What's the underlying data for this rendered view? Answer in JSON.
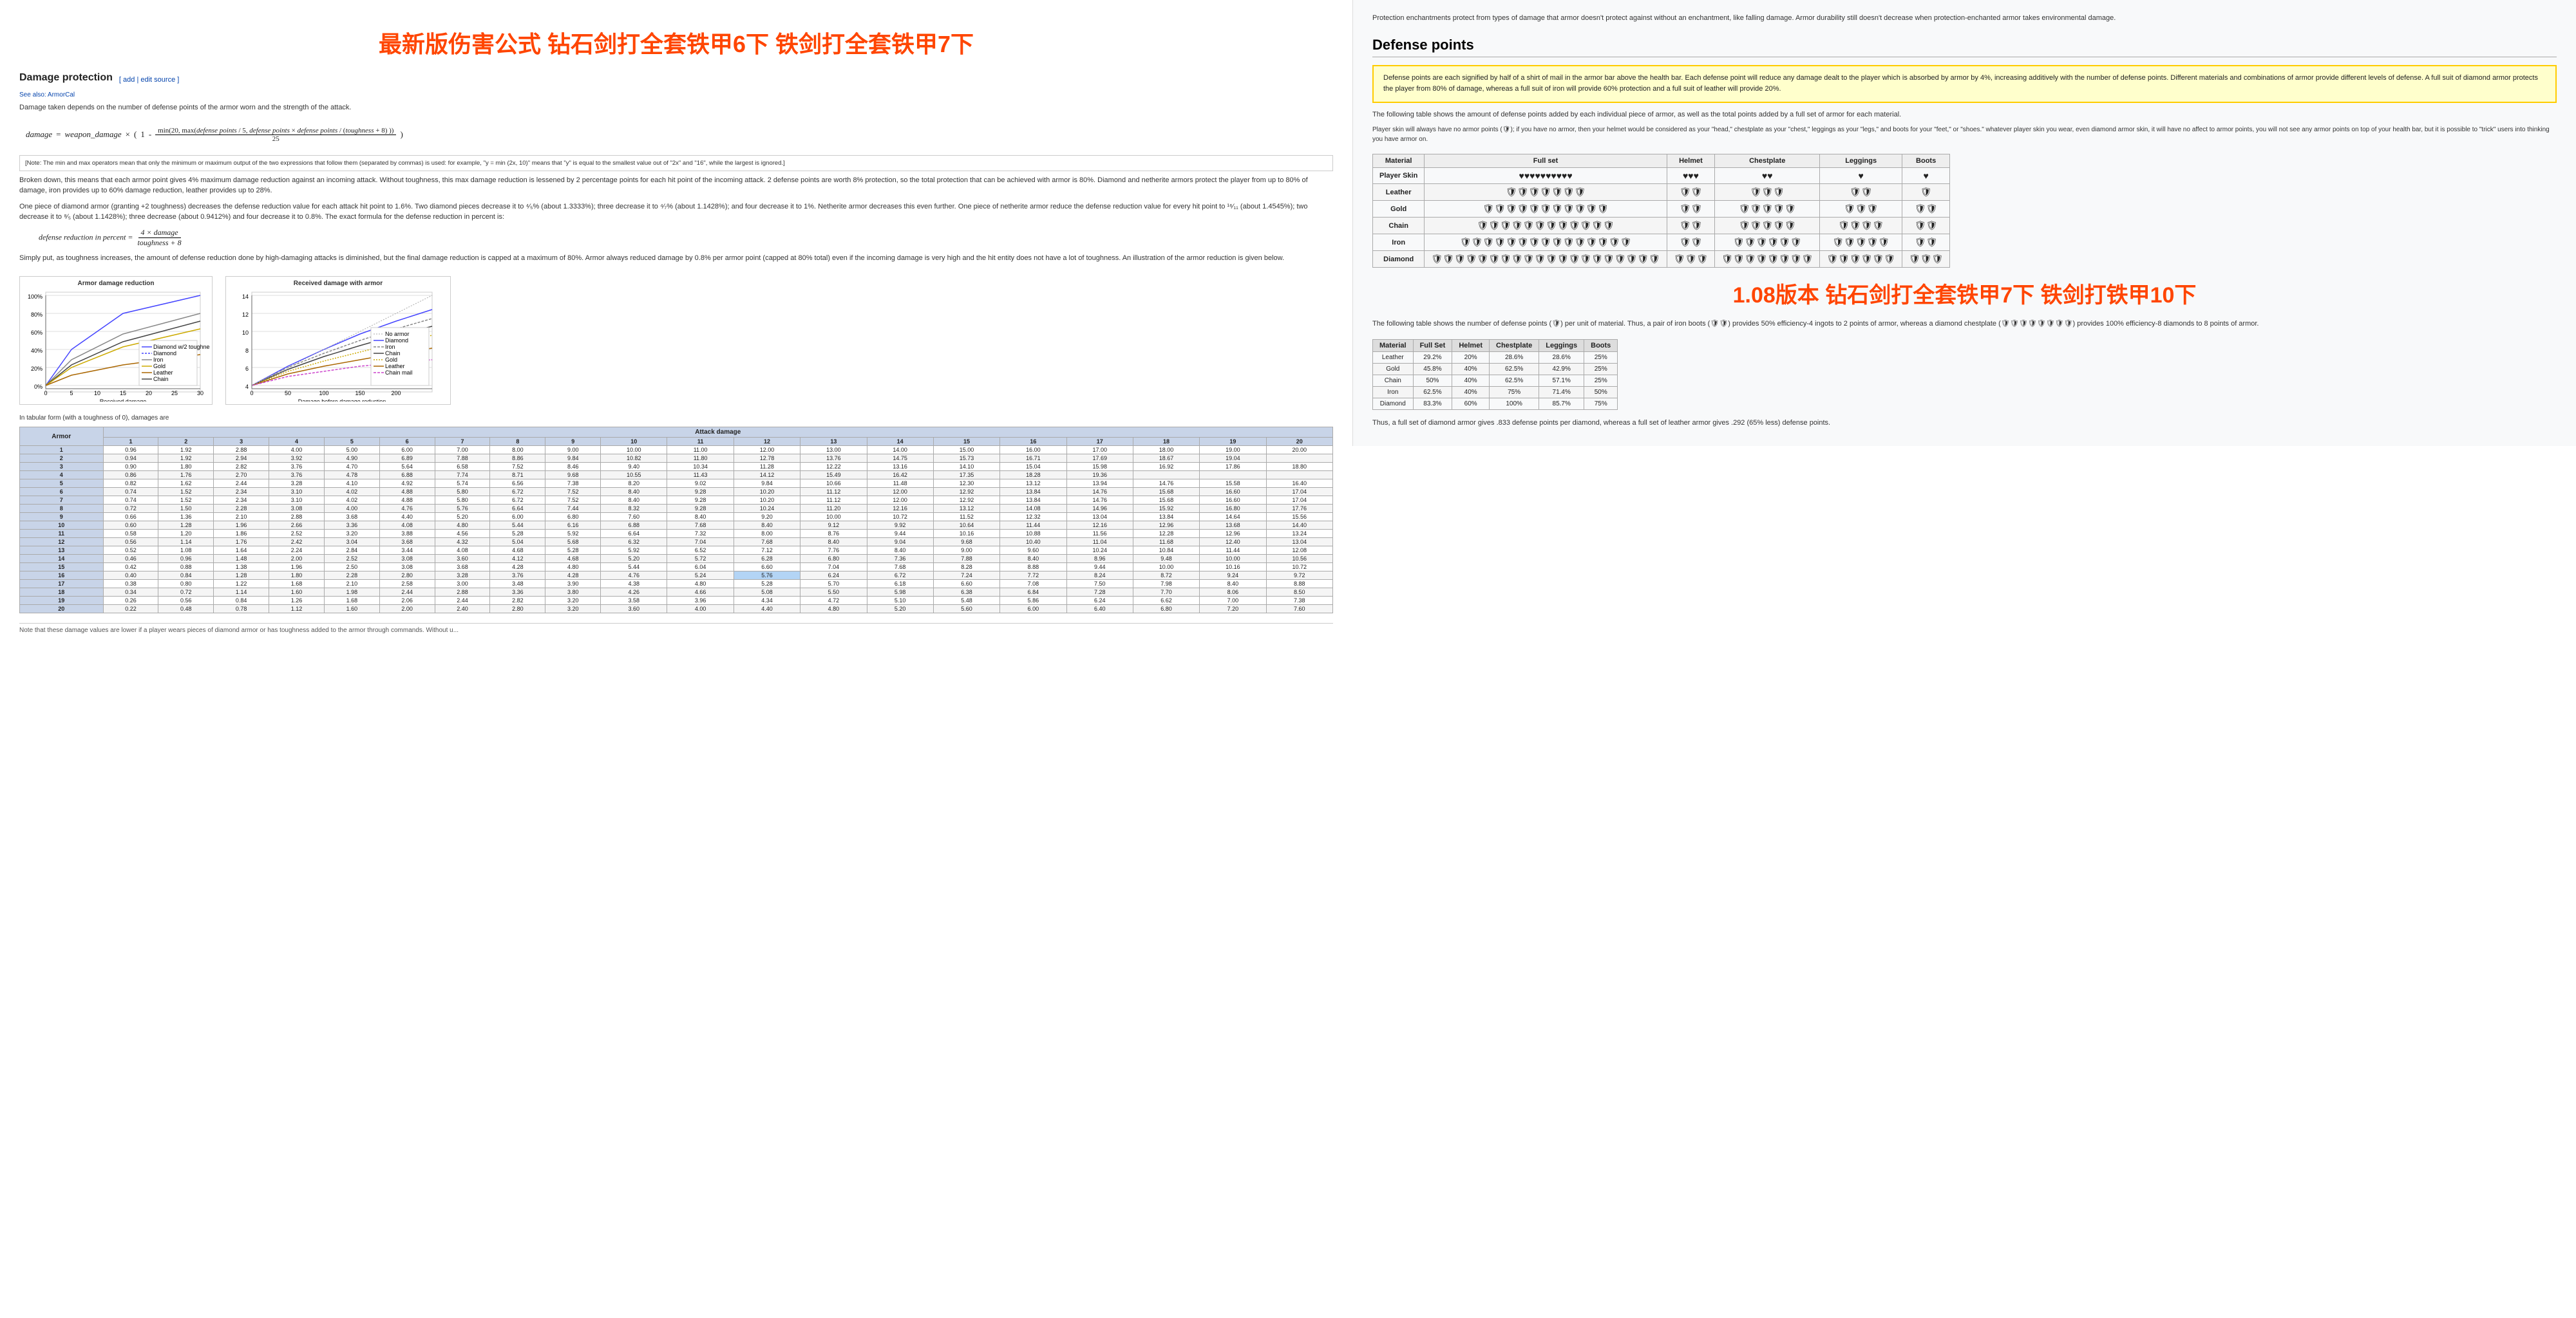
{
  "left": {
    "dp_title": "Damage protection",
    "edit_label": "[ add | edit source ]",
    "see_also": "See also: ArmorCal",
    "dp_intro": "Damage taken depends on the number of defense points of the armor worn and the strength of the attack.",
    "formula_label": "damage = weapon_damage × ( 1 -",
    "formula_inner": "max( 20, max( defense points / 5 × defense points / (toughness + 8) ) )",
    "formula_denom": "25",
    "note_text": "[Note: The min and max operators mean that only the minimum or maximum output of the two expressions that follow them (separated by commas) is used: for example, \"y = min (2x, 10)\" means that \"y\" is equal to the smallest value out of \"2x\" and \"16\", while the largest is ignored.]",
    "broken_down": "Broken down, this means that each armor point gives 4% maximum damage reduction against an incoming attack. Without toughness, this max damage reduction is lessened by 2 percentage points for each hit point of the incoming attack. 2 defense points are worth 8% protection, so the total protection that can be achieved with armor is 80%. Diamond and netherite armors protect the player from up to 80% of damage, iron provides up to 60% damage reduction, leather provides up to 28%.",
    "one_piece": "One piece of diamond armor (granting +2 toughness) decreases the defense reduction value for each attack hit point to 1.6%. Two diamond pieces decrease it to ⁴⁄₅% (about 1.3333%); three decrease it to ⁴⁄₇% (about 1.1428%); and four decrease it to 1%. Netherite armor decreases this even further. One piece of netherite armor reduce the defense reduction value for every hit point to ¹⁶⁄₁₁ (about 1.4545%); two decrease it to ⁸⁄₅ (about 1.1428%); three decrease (about 0.9412%) and four decrease it to 0.8%. The exact formula for the defense reduction in percent is:",
    "def_formula": "defense reduction in percent = (4 × damage) / (toughness + 8)",
    "simply_put": "Simply put, as toughness increases, the amount of defense reduction done by high-damaging attacks is diminished, but the final damage reduction is capped at a maximum of 80%. Armor always reduced damage by 0.8% per armor point (capped at 80% total) even if the incoming damage is very high and the hit entity does not have a lot of toughness. An illustration of the armor reduction is given below.",
    "chart1_title": "Armor damage reduction",
    "chart2_title": "Received damage with armor",
    "tabular_note": "In tabular form (with a toughness of 0), damages are",
    "attack_damage_label": "Attack damage",
    "armor_label": "Armor",
    "col_headers": [
      "1",
      "2",
      "3",
      "4",
      "5",
      "6",
      "7",
      "8",
      "9",
      "10",
      "11",
      "12",
      "13",
      "14",
      "15",
      "16",
      "17",
      "18",
      "19",
      "20"
    ],
    "row_headers": [
      "1",
      "2",
      "3",
      "4",
      "5",
      "6",
      "7",
      "8",
      "9",
      "10",
      "11",
      "12",
      "13",
      "14",
      "15",
      "16",
      "17",
      "18",
      "19",
      "20"
    ],
    "table_data": [
      [
        0.96,
        1.92,
        2.88,
        4.0,
        5.0,
        6.0,
        7.0,
        8.0,
        9.0,
        10.0,
        11.0,
        12.0,
        13.0,
        14.0,
        15.0,
        16.0,
        17.0,
        18.0,
        19.0,
        20.0
      ],
      [
        0.94,
        1.92,
        2.94,
        3.92,
        4.9,
        6.89,
        7.88,
        8.86,
        9.84,
        10.82,
        11.8,
        12.78,
        13.76,
        14.75,
        15.73,
        16.71,
        17.69,
        18.67,
        19.04
      ],
      [
        0.9,
        1.8,
        2.82,
        3.76,
        4.7,
        5.64,
        6.58,
        7.52,
        8.46,
        9.4,
        10.34,
        11.28,
        12.22,
        13.16,
        14.1,
        15.04,
        15.98,
        16.92,
        17.86,
        18.8
      ],
      [
        0.86,
        1.76,
        2.7,
        3.76,
        4.78,
        6.88,
        7.74,
        8.71,
        9.68,
        10.55,
        11.43,
        14.12,
        15.49,
        16.42,
        17.35,
        18.28,
        19.36
      ],
      [
        0.82,
        1.62,
        2.44,
        3.28,
        4.1,
        4.92,
        5.74,
        6.56,
        7.38,
        8.2,
        9.02,
        9.84,
        10.66,
        11.48,
        12.3,
        13.12,
        13.94,
        14.76,
        15.58,
        16.4
      ],
      [
        0.74,
        1.52,
        2.34,
        3.1,
        4.02,
        4.88,
        5.8,
        6.72,
        7.52,
        8.4,
        9.28,
        10.2,
        11.12,
        12.0,
        12.92,
        13.84,
        14.76,
        15.68,
        16.6,
        17.04
      ],
      [
        0.74,
        1.52,
        2.34,
        3.1,
        4.02,
        4.88,
        5.8,
        6.72,
        7.52,
        8.4,
        9.28,
        10.2,
        11.12,
        12.0,
        12.92,
        13.84,
        14.76,
        15.68,
        16.6,
        17.04
      ],
      [
        0.72,
        1.5,
        2.28,
        3.08,
        4.0,
        4.76,
        5.76,
        6.64,
        7.44,
        8.32,
        9.28,
        10.24,
        11.2,
        12.16,
        13.12,
        14.08,
        14.96,
        15.92,
        16.8,
        17.76
      ],
      [
        0.66,
        1.36,
        2.1,
        2.88,
        3.68,
        4.4,
        5.2,
        6.0,
        6.8,
        7.6,
        8.4,
        9.2,
        10.0,
        10.72,
        11.52,
        12.32,
        13.04,
        13.84,
        14.64,
        15.56
      ],
      [
        0.6,
        1.28,
        1.96,
        2.66,
        3.36,
        4.08,
        4.8,
        5.44,
        6.16,
        6.88,
        7.68,
        8.4,
        9.12,
        9.92,
        10.64,
        11.44,
        12.16,
        12.96,
        13.68,
        14.4
      ],
      [
        0.58,
        1.2,
        1.86,
        2.52,
        3.2,
        3.88,
        4.56,
        5.28,
        5.92,
        6.64,
        7.32,
        8.0,
        8.76,
        9.44,
        10.16,
        10.88,
        11.56,
        12.28,
        12.96,
        13.24
      ],
      [
        0.56,
        1.14,
        1.76,
        2.42,
        3.04,
        3.68,
        4.32,
        5.04,
        5.68,
        6.32,
        7.04,
        7.68,
        8.4,
        9.04,
        9.68,
        10.4,
        11.04,
        11.68,
        12.4,
        13.04
      ],
      [
        0.52,
        1.08,
        1.64,
        2.24,
        2.84,
        3.44,
        4.08,
        4.68,
        5.28,
        5.92,
        6.52,
        7.12,
        7.76,
        8.4,
        9.0,
        9.6,
        10.24,
        10.84,
        11.44,
        12.08
      ],
      [
        0.46,
        0.96,
        1.48,
        2.0,
        2.52,
        3.08,
        3.6,
        4.12,
        4.68,
        5.2,
        5.72,
        6.28,
        6.8,
        7.36,
        7.88,
        8.4,
        8.96,
        9.48,
        10.0,
        10.56
      ],
      [
        0.42,
        0.88,
        1.38,
        1.96,
        2.5,
        3.08,
        3.68,
        4.28,
        4.8,
        5.44,
        6.04,
        6.6,
        7.04,
        7.68,
        8.28,
        8.88,
        9.44,
        10.0,
        10.16,
        10.72
      ],
      [
        0.4,
        0.84,
        1.28,
        1.8,
        2.28,
        2.8,
        3.28,
        3.76,
        4.28,
        4.76,
        5.24,
        5.76,
        6.24,
        6.72,
        7.24,
        7.72,
        8.24,
        8.72,
        9.24,
        9.72
      ],
      [
        0.38,
        0.8,
        1.22,
        1.68,
        2.1,
        2.58,
        3.0,
        3.48,
        3.9,
        4.38,
        4.8,
        5.28,
        5.7,
        6.18,
        6.6,
        7.08,
        7.5,
        7.98,
        8.4,
        8.88
      ],
      [
        0.34,
        0.72,
        1.14,
        1.6,
        1.98,
        2.44,
        2.88,
        3.36,
        3.8,
        4.26,
        4.66,
        5.08,
        5.5,
        5.98,
        6.38,
        6.84,
        7.28,
        7.7,
        8.06,
        8.5
      ],
      [
        0.26,
        0.56,
        0.84,
        1.26,
        1.68,
        2.06,
        2.44,
        2.82,
        3.2,
        3.58,
        3.96,
        4.34,
        4.72,
        5.1,
        5.48,
        5.86,
        6.24,
        6.62,
        7.0,
        7.38
      ],
      [
        0.22,
        0.48,
        0.78,
        1.12,
        1.6,
        2.0,
        2.4,
        2.8,
        3.2,
        3.6,
        4.0,
        4.4,
        4.8,
        5.2,
        5.6,
        6.0,
        6.4,
        6.8,
        7.2,
        7.6
      ]
    ],
    "table_footer": "Note that these damage values are lower if a player wears pieces of diamond armor or has toughness added to the armor through commands. Without u...",
    "chinese_top": "最新版伤害公式 钻石剑打全套铁甲6下 铁剑打全套铁甲7下"
  },
  "right": {
    "protection_text": "Protection enchantments protect from types of damage that armor doesn't protect against without an enchantment, like falling damage. Armor durability still doesn't decrease when protection-enchanted armor takes environmental damage.",
    "defense_title": "Defense points",
    "defense_desc": "Defense points are each signified by half of a shirt of mail in the armor bar above the health bar. Each defense point will reduce any damage dealt to the player which is absorbed by armor by 4%, increasing additively with the number of defense points. Different materials and combinations of armor provide different levels of defense. A full suit of diamond armor protects the player from 80% of damage, whereas a full suit of iron will provide 60% protection and a full suit of leather will provide 20%.",
    "following_table": "The following table shows the amount of defense points added by each individual piece of armor, as well as the total points added by a full set of armor for each material.",
    "no_armor_text": "Player skin will always have no armor points (🛡); if you have no armor, then your helmet would be considered as your \"head,\" chestplate as your \"chest,\" leggings as your \"legs,\" and boots for your \"feet,\" or \"shoes.\" whatever player skin you wear, even diamond armor skin, it will have no affect to armor points, you will not see any armor points on top of your health bar, but it is possible to \"trick\" users into thinking you have armor on.",
    "defense_table": {
      "cols": [
        "Material",
        "Full set",
        "Helmet",
        "Chestplate",
        "Leggings",
        "Boots"
      ],
      "rows": [
        {
          "material": "Player Skin",
          "full": "♥♥♥♥♥♥♥♥♥♥",
          "helmet": "♥♥♥",
          "chestplate": "♥♥",
          "leggings": "♥",
          "boots": "♥"
        },
        {
          "material": "Leather",
          "full": "🛡🛡🛡🛡🛡🛡🛡",
          "helmet": "🛡🛡",
          "chestplate": "🛡🛡🛡",
          "leggings": "🛡🛡",
          "boots": "🛡"
        },
        {
          "material": "Gold",
          "full": "🛡🛡🛡🛡🛡🛡🛡🛡🛡🛡🛡",
          "helmet": "🛡🛡",
          "chestplate": "🛡🛡🛡🛡🛡",
          "leggings": "🛡🛡🛡",
          "boots": "🛡🛡"
        },
        {
          "material": "Chain",
          "full": "🛡🛡🛡🛡🛡🛡🛡🛡🛡🛡🛡🛡",
          "helmet": "🛡🛡",
          "chestplate": "🛡🛡🛡🛡🛡",
          "leggings": "🛡🛡🛡🛡",
          "boots": "🛡🛡"
        },
        {
          "material": "Iron",
          "full": "🛡🛡🛡🛡🛡🛡🛡🛡🛡🛡🛡🛡🛡🛡🛡",
          "helmet": "🛡🛡",
          "chestplate": "🛡🛡🛡🛡🛡🛡",
          "leggings": "🛡🛡🛡🛡🛡",
          "boots": "🛡🛡"
        },
        {
          "material": "Diamond",
          "full": "🛡🛡🛡🛡🛡🛡🛡🛡🛡🛡🛡🛡🛡🛡🛡🛡🛡🛡🛡🛡",
          "helmet": "🛡🛡🛡",
          "chestplate": "🛡🛡🛡🛡🛡🛡🛡🛡",
          "leggings": "🛡🛡🛡🛡🛡🛡",
          "boots": "🛡🛡🛡"
        }
      ]
    },
    "chinese_sub": "1.08版本 钻石剑打全套铁甲7下 铁剑打铁甲10下",
    "following_table2": "The following table shows the number of defense points (🛡) per unit of material. Thus, a pair of iron boots (🛡🛡) provides 50% efficiency-4 ingots to 2 points of armor, whereas a diamond chestplate (🛡🛡🛡🛡🛡🛡🛡🛡) provides 100% efficiency-8 diamonds to 8 points of armor.",
    "pct_table": {
      "cols": [
        "Material",
        "Full Set",
        "Helmet",
        "Chestplate",
        "Leggings",
        "Boots"
      ],
      "rows": [
        {
          "material": "Leather",
          "full": "29.2%",
          "helmet": "20%",
          "chestplate": "28.6%",
          "leggings": "28.6%",
          "boots": "25%"
        },
        {
          "material": "Gold",
          "full": "45.8%",
          "helmet": "40%",
          "chestplate": "62.5%",
          "leggings": "42.9%",
          "boots": "25%"
        },
        {
          "material": "Chain",
          "full": "50%",
          "helmet": "40%",
          "chestplate": "62.5%",
          "leggings": "57.1%",
          "boots": "25%"
        },
        {
          "material": "Iron",
          "full": "62.5%",
          "helmet": "40%",
          "chestplate": "75%",
          "leggings": "71.4%",
          "boots": "50%"
        },
        {
          "material": "Diamond",
          "full": "83.3%",
          "helmet": "60%",
          "chestplate": "100%",
          "leggings": "85.7%",
          "boots": "75%"
        }
      ]
    },
    "diamond_note": "Thus, a full set of diamond armor gives .833 defense points per diamond, whereas a full set of leather armor gives .292 (65% less) defense points."
  }
}
